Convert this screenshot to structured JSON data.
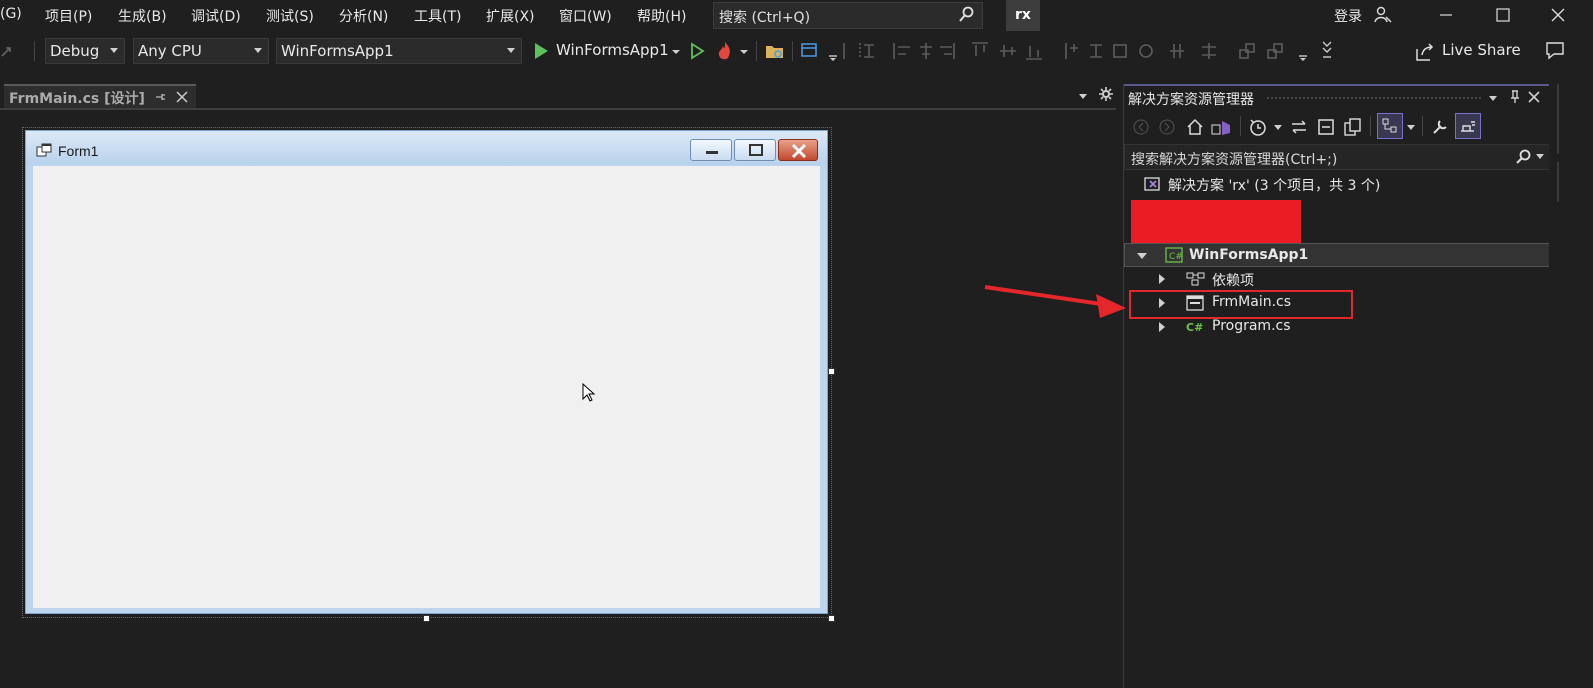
{
  "menu": {
    "items": [
      "(G)",
      "项目(P)",
      "生成(B)",
      "调试(D)",
      "测试(S)",
      "分析(N)",
      "工具(T)",
      "扩展(X)",
      "窗口(W)",
      "帮助(H)"
    ],
    "search_placeholder": "搜索 (Ctrl+Q)",
    "solution_badge": "rx",
    "login": "登录"
  },
  "toolbar": {
    "config": "Debug",
    "platform": "Any CPU",
    "startup_project": "WinFormsApp1",
    "run_label": "WinFormsApp1",
    "live_share": "Live Share"
  },
  "editor": {
    "tab_label": "FrmMain.cs [设计]",
    "form_title": "Form1"
  },
  "solution_explorer": {
    "title": "解决方案资源管理器",
    "search_placeholder": "搜索解决方案资源管理器(Ctrl+;)",
    "solution_label": "解决方案 'rx' (3 个项目，共 3 个)",
    "project": "WinFormsApp1",
    "items": [
      "依赖项",
      "FrmMain.cs",
      "Program.cs"
    ]
  },
  "colors": {
    "background": "#1f1f1f",
    "annotation_red": "#e3272b",
    "redaction": "#ec1c24",
    "csharp_green": "#6cc24a"
  }
}
